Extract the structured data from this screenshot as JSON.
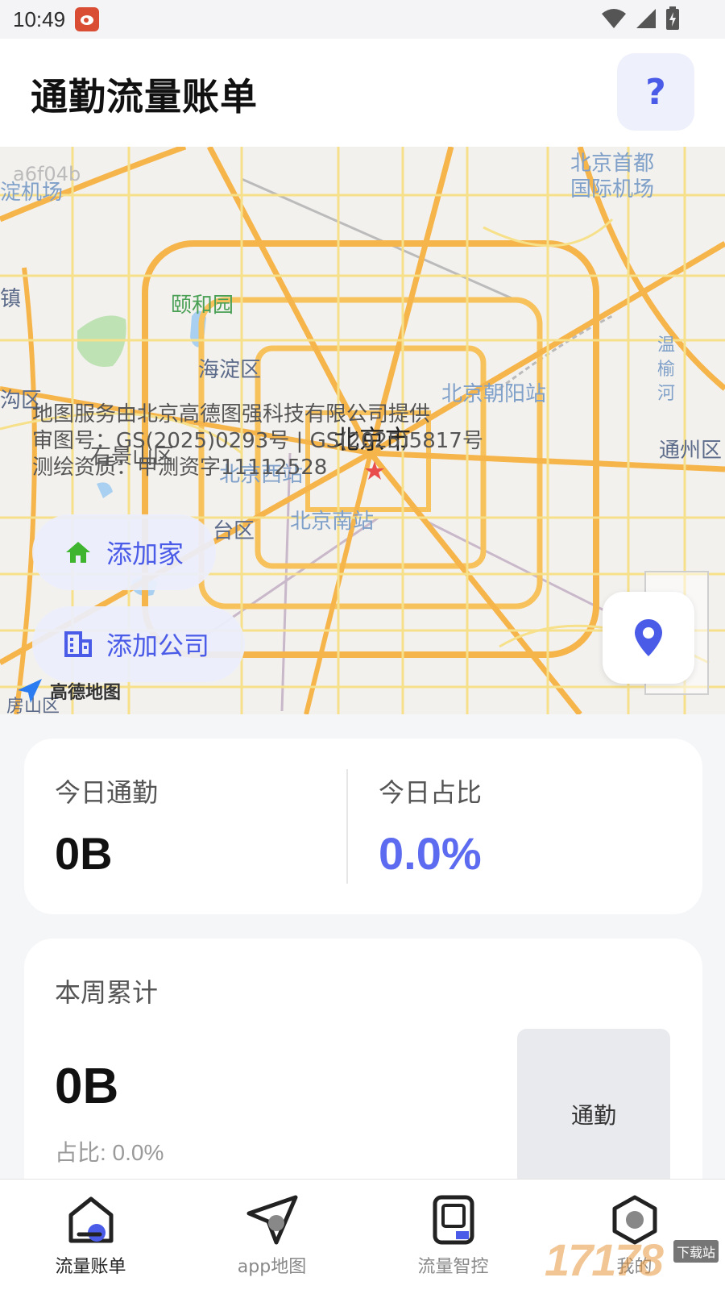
{
  "status_bar": {
    "time": "10:49"
  },
  "header": {
    "title": "通勤流量账单",
    "help_label": "?"
  },
  "map": {
    "labels": {
      "airport_west": "淀机场",
      "code": "a6f04b",
      "airport_capital_1": "北京首都",
      "airport_capital_2": "国际机场",
      "zhen": "镇",
      "summer_palace": "颐和园",
      "haidian": "海淀区",
      "chaoyang_station": "北京朝阳站",
      "goqu": "沟区",
      "wenyu_1": "温",
      "wenyu_2": "榆",
      "wenyu_3": "河",
      "beijing_city": "北京市",
      "shijingshan": "石景山区",
      "west_station": "北京西站",
      "tongzhou": "通州区",
      "fengtai": "台区",
      "south_station": "北京南站",
      "fangshan": "房山区"
    },
    "attribution": {
      "line1": "地图服务由北京高德图强科技有限公司提供",
      "line2": "审图号：GS(2025)0293号 | GS(2025)5817号",
      "line3": "测绘资质：甲测资字11112528"
    },
    "logo_text": "高德地图",
    "add_home_label": "添加家",
    "add_company_label": "添加公司",
    "colors": {
      "road_major": "#f7c25c",
      "road_minor": "#f6e08a",
      "accent": "#4a5be8",
      "home_icon": "#3fb52f"
    }
  },
  "today_card": {
    "commute_label": "今日通勤",
    "commute_value": "0B",
    "ratio_label": "今日占比",
    "ratio_value": "0.0%"
  },
  "week_card": {
    "title": "本周累计",
    "value": "0B",
    "ratio_text": "占比: 0.0%",
    "bar_label": "通勤"
  },
  "bottom_nav": {
    "items": [
      {
        "label": "流量账单",
        "icon": "home-bill-icon"
      },
      {
        "label": "app地图",
        "icon": "paper-plane-icon"
      },
      {
        "label": "流量智控",
        "icon": "device-control-icon"
      },
      {
        "label": "我的",
        "icon": "profile-hex-icon"
      }
    ]
  },
  "watermark": {
    "text": "17178",
    "badge": "下载站"
  }
}
